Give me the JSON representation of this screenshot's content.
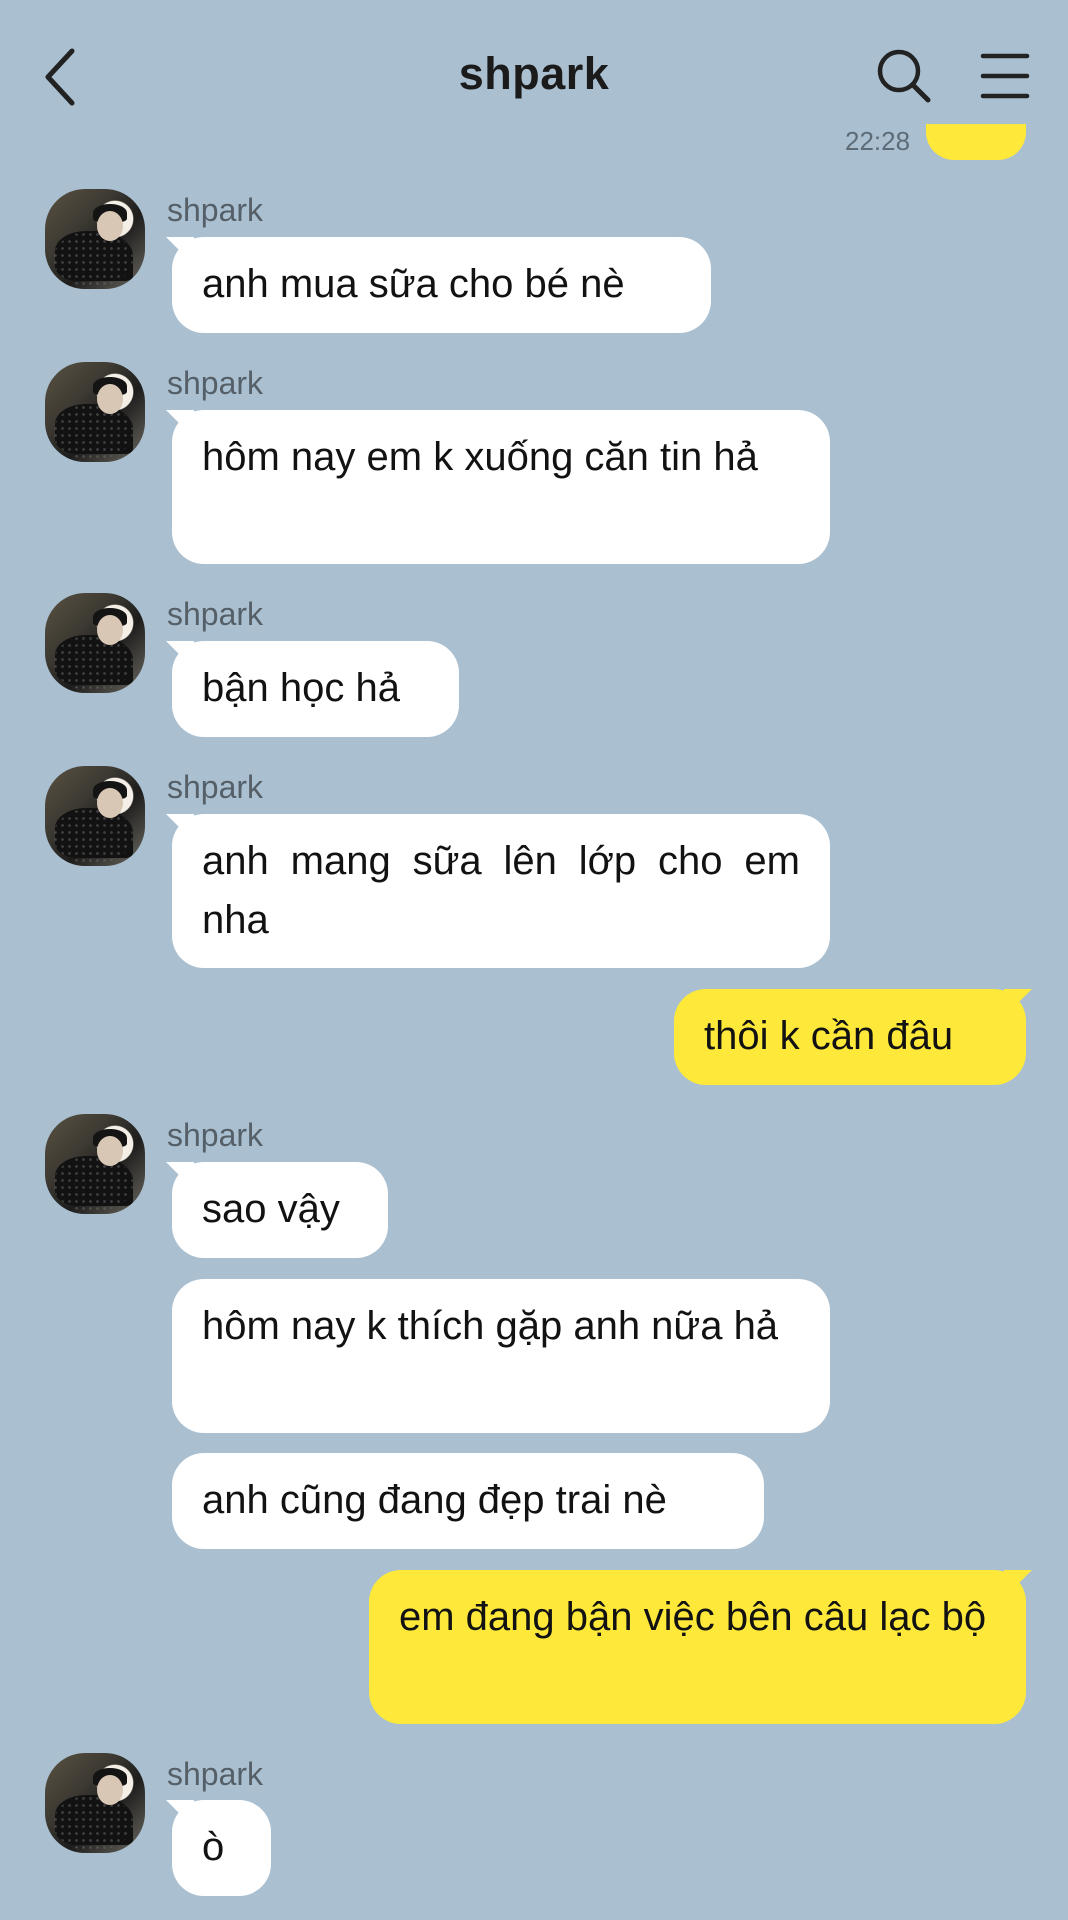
{
  "header": {
    "title": "shpark"
  },
  "partial": {
    "time": "22:28"
  },
  "messages": [
    {
      "sender": "shpark",
      "text": "anh mua sữa cho bé nè"
    },
    {
      "sender": "shpark",
      "text": "hôm nay em k xuống căn tin hả"
    },
    {
      "sender": "shpark",
      "text": "bận học hả"
    },
    {
      "sender": "shpark",
      "text": "anh mang sữa lên lớp cho em nha"
    },
    {
      "sender": "me",
      "text": "thôi k cần đâu"
    },
    {
      "sender": "shpark",
      "text": "sao vậy"
    },
    {
      "sender": "shpark",
      "text": "hôm nay k thích gặp anh nữa hả"
    },
    {
      "sender": "shpark",
      "text": "anh cũng đang đẹp trai nè"
    },
    {
      "sender": "me",
      "text": "em đang bận việc bên câu lạc bộ"
    },
    {
      "sender": "shpark",
      "text": "ò"
    }
  ],
  "colors": {
    "background": "#aac0d1",
    "outgoing": "#fee93a",
    "incoming": "#ffffff"
  }
}
